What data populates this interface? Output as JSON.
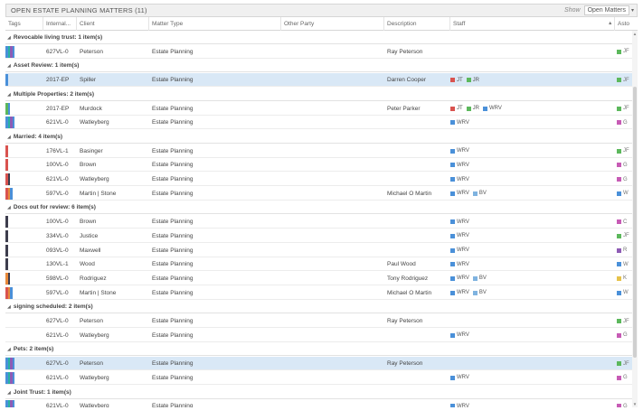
{
  "titlebar": {
    "title": "OPEN ESTATE PLANNING MATTERS (11)",
    "show_label": "Show",
    "show_value": "Open Matters",
    "dropdown_icon": "chevron-down-icon"
  },
  "columns": [
    "Tags",
    "Internal...",
    "Client",
    "Matter Type",
    "Other Party",
    "Description",
    "Staff",
    "Asto"
  ],
  "colors": {
    "red": "#d9534f",
    "green": "#5cb85c",
    "blue": "#4a90d9",
    "teal": "#27b3a3",
    "purple": "#8e5bb5",
    "orange": "#e8893a",
    "dark": "#3d3d4d",
    "magenta": "#c75bb5",
    "yellow": "#e6c24a",
    "lblue": "#7fb3e0",
    "selected": "#d9e8f6"
  },
  "rows": [
    {
      "kind": "group",
      "label": "Revocable living trust: 1 item(s)"
    },
    {
      "kind": "data",
      "tags": [
        "blue",
        "teal",
        "purple",
        "blue"
      ],
      "internal": "627VL-0",
      "client": "Peterson",
      "matter": "Estate Planning",
      "other": "",
      "desc": "Ray Peterson",
      "staff": [],
      "asgn": "JF",
      "asgn_color": "green"
    },
    {
      "kind": "group",
      "label": "Asset Review: 1 item(s)"
    },
    {
      "kind": "data",
      "selected": true,
      "tags": [
        "blue"
      ],
      "internal": "2017-EP",
      "client": "Spiller",
      "matter": "Estate Planning",
      "other": "",
      "desc": "Darren Cooper",
      "staff": [
        {
          "c": "red",
          "t": "JT"
        },
        {
          "c": "green",
          "t": "JR"
        }
      ],
      "asgn": "JF",
      "asgn_color": "green"
    },
    {
      "kind": "group",
      "label": "Multiple Properties: 2 item(s)"
    },
    {
      "kind": "data",
      "tags": [
        "green",
        "blue"
      ],
      "internal": "2017-EP",
      "client": "Murdock",
      "matter": "Estate Planning",
      "other": "",
      "desc": "Peter Parker",
      "staff": [
        {
          "c": "red",
          "t": "JT"
        },
        {
          "c": "green",
          "t": "JR"
        },
        {
          "c": "blue",
          "t": "WRV"
        }
      ],
      "asgn": "JF",
      "asgn_color": "green"
    },
    {
      "kind": "data",
      "tags": [
        "blue",
        "teal",
        "purple",
        "blue"
      ],
      "internal": "621VL-0",
      "client": "Watleyberg",
      "matter": "Estate Planning",
      "other": "",
      "desc": "",
      "staff": [
        {
          "c": "blue",
          "t": "WRV"
        }
      ],
      "asgn": "G",
      "asgn_color": "magenta"
    },
    {
      "kind": "group",
      "label": "Married: 4 item(s)"
    },
    {
      "kind": "data",
      "tags": [
        "red"
      ],
      "internal": "176VL-1",
      "client": "Basinger",
      "matter": "Estate Planning",
      "other": "",
      "desc": "",
      "staff": [
        {
          "c": "blue",
          "t": "WRV"
        }
      ],
      "asgn": "JF",
      "asgn_color": "green"
    },
    {
      "kind": "data",
      "tags": [
        "red"
      ],
      "internal": "100VL-0",
      "client": "Brown",
      "matter": "Estate Planning",
      "other": "",
      "desc": "",
      "staff": [
        {
          "c": "blue",
          "t": "WRV"
        }
      ],
      "asgn": "G",
      "asgn_color": "magenta"
    },
    {
      "kind": "data",
      "tags": [
        "red",
        "dark"
      ],
      "internal": "621VL-0",
      "client": "Watleyberg",
      "matter": "Estate Planning",
      "other": "",
      "desc": "",
      "staff": [
        {
          "c": "blue",
          "t": "WRV"
        }
      ],
      "asgn": "G",
      "asgn_color": "magenta"
    },
    {
      "kind": "data",
      "tags": [
        "red",
        "orange",
        "blue"
      ],
      "internal": "597VL-0",
      "client": "Martin | Stone",
      "matter": "Estate Planning",
      "other": "",
      "desc": "Michael O Martin",
      "staff": [
        {
          "c": "blue",
          "t": "WRV"
        },
        {
          "c": "lblue",
          "t": "BV"
        }
      ],
      "asgn": "W",
      "asgn_color": "blue"
    },
    {
      "kind": "group",
      "label": "Docs out for review: 6 item(s)"
    },
    {
      "kind": "data",
      "tags": [
        "dark"
      ],
      "internal": "100VL-0",
      "client": "Brown",
      "matter": "Estate Planning",
      "other": "",
      "desc": "",
      "staff": [
        {
          "c": "blue",
          "t": "WRV"
        }
      ],
      "asgn": "C",
      "asgn_color": "magenta"
    },
    {
      "kind": "data",
      "tags": [
        "dark"
      ],
      "internal": "334VL-0",
      "client": "Justice",
      "matter": "Estate Planning",
      "other": "",
      "desc": "",
      "staff": [
        {
          "c": "blue",
          "t": "WRV"
        }
      ],
      "asgn": "JF",
      "asgn_color": "green"
    },
    {
      "kind": "data",
      "tags": [
        "dark"
      ],
      "internal": "093VL-0",
      "client": "Maxwell",
      "matter": "Estate Planning",
      "other": "",
      "desc": "",
      "staff": [
        {
          "c": "blue",
          "t": "WRV"
        }
      ],
      "asgn": "R",
      "asgn_color": "purple"
    },
    {
      "kind": "data",
      "tags": [
        "dark"
      ],
      "internal": "130VL-1",
      "client": "Wood",
      "matter": "Estate Planning",
      "other": "",
      "desc": "Paul Wood",
      "staff": [
        {
          "c": "blue",
          "t": "WRV"
        }
      ],
      "asgn": "W",
      "asgn_color": "blue"
    },
    {
      "kind": "data",
      "tags": [
        "orange",
        "dark"
      ],
      "internal": "598VL-0",
      "client": "Rodriguez",
      "matter": "Estate Planning",
      "other": "",
      "desc": "Tony Rodriguez",
      "staff": [
        {
          "c": "blue",
          "t": "WRV"
        },
        {
          "c": "lblue",
          "t": "BV"
        }
      ],
      "asgn": "K",
      "asgn_color": "yellow"
    },
    {
      "kind": "data",
      "tags": [
        "red",
        "orange",
        "blue"
      ],
      "internal": "597VL-0",
      "client": "Martin | Stone",
      "matter": "Estate Planning",
      "other": "",
      "desc": "Michael O Martin",
      "staff": [
        {
          "c": "blue",
          "t": "WRV"
        },
        {
          "c": "lblue",
          "t": "BV"
        }
      ],
      "asgn": "W",
      "asgn_color": "blue"
    },
    {
      "kind": "group",
      "label": "signing scheduled: 2 item(s)"
    },
    {
      "kind": "data",
      "tags": [],
      "internal": "627VL-0",
      "client": "Peterson",
      "matter": "Estate Planning",
      "other": "",
      "desc": "Ray Peterson",
      "staff": [],
      "asgn": "JF",
      "asgn_color": "green"
    },
    {
      "kind": "data",
      "tags": [],
      "internal": "621VL-0",
      "client": "Watleyberg",
      "matter": "Estate Planning",
      "other": "",
      "desc": "",
      "staff": [
        {
          "c": "blue",
          "t": "WRV"
        }
      ],
      "asgn": "G",
      "asgn_color": "magenta"
    },
    {
      "kind": "group",
      "label": "Pets: 2 item(s)"
    },
    {
      "kind": "data",
      "selected": true,
      "tags": [
        "blue",
        "teal",
        "purple",
        "blue"
      ],
      "internal": "627VL-0",
      "client": "Peterson",
      "matter": "Estate Planning",
      "other": "",
      "desc": "Ray Peterson",
      "staff": [],
      "asgn": "JF",
      "asgn_color": "green"
    },
    {
      "kind": "data",
      "tags": [
        "blue",
        "teal",
        "purple",
        "blue"
      ],
      "internal": "621VL-0",
      "client": "Watleyberg",
      "matter": "Estate Planning",
      "other": "",
      "desc": "",
      "staff": [
        {
          "c": "blue",
          "t": "WRV"
        }
      ],
      "asgn": "G",
      "asgn_color": "magenta"
    },
    {
      "kind": "group",
      "label": "Joint Trust: 1 item(s)"
    },
    {
      "kind": "data",
      "tags": [
        "blue",
        "teal",
        "purple",
        "blue"
      ],
      "internal": "621VL-0",
      "client": "Watleyberg",
      "matter": "Estate Planning",
      "other": "",
      "desc": "",
      "staff": [
        {
          "c": "blue",
          "t": "WRV"
        }
      ],
      "asgn": "G",
      "asgn_color": "magenta"
    }
  ]
}
